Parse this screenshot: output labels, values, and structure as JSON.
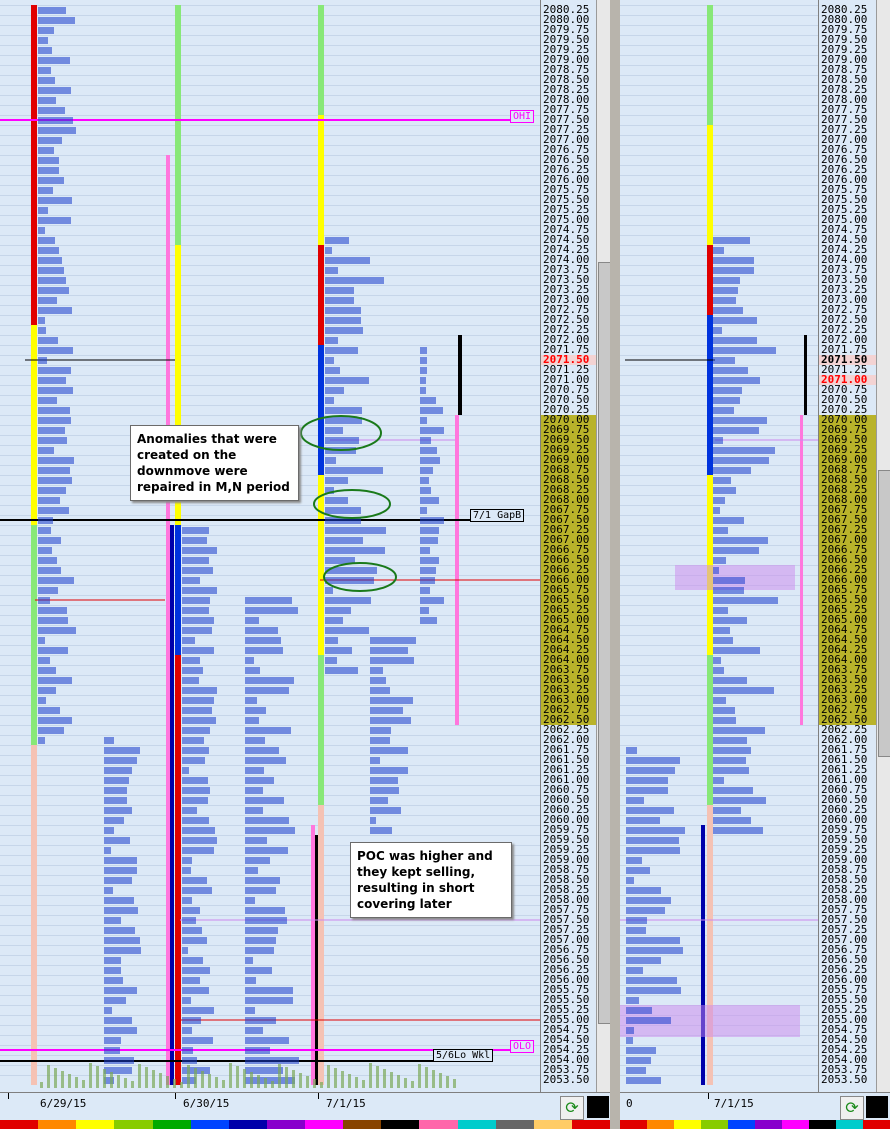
{
  "price_scale": {
    "prices": [
      "2080.25",
      "2080.00",
      "2079.75",
      "2079.50",
      "2079.25",
      "2079.00",
      "2078.75",
      "2078.50",
      "2078.25",
      "2078.00",
      "2077.75",
      "2077.50",
      "2077.25",
      "2077.00",
      "2076.75",
      "2076.50",
      "2076.25",
      "2076.00",
      "2075.75",
      "2075.50",
      "2075.25",
      "2075.00",
      "2074.75",
      "2074.50",
      "2074.25",
      "2074.00",
      "2073.75",
      "2073.50",
      "2073.25",
      "2073.00",
      "2072.75",
      "2072.50",
      "2072.25",
      "2072.00",
      "2071.75",
      "2071.50",
      "2071.25",
      "2071.00",
      "2070.75",
      "2070.50",
      "2070.25",
      "2070.00",
      "2069.75",
      "2069.50",
      "2069.25",
      "2069.00",
      "2068.75",
      "2068.50",
      "2068.25",
      "2068.00",
      "2067.75",
      "2067.50",
      "2067.25",
      "2067.00",
      "2066.75",
      "2066.50",
      "2066.25",
      "2066.00",
      "2065.75",
      "2065.50",
      "2065.25",
      "2065.00",
      "2064.75",
      "2064.50",
      "2064.25",
      "2064.00",
      "2063.75",
      "2063.50",
      "2063.25",
      "2063.00",
      "2062.75",
      "2062.50",
      "2062.25",
      "2062.00",
      "2061.75",
      "2061.50",
      "2061.25",
      "2061.00",
      "2060.75",
      "2060.50",
      "2060.25",
      "2060.00",
      "2059.75",
      "2059.50",
      "2059.25",
      "2059.00",
      "2058.75",
      "2058.50",
      "2058.25",
      "2058.00",
      "2057.75",
      "2057.50",
      "2057.25",
      "2057.00",
      "2056.75",
      "2056.50",
      "2056.25",
      "2056.00",
      "2055.75",
      "2055.50",
      "2055.25",
      "2055.00",
      "2054.75",
      "2054.50",
      "2054.25",
      "2054.00",
      "2053.75",
      "2053.50"
    ],
    "value_area_high": "2070.00",
    "value_area_low": "2062.50",
    "current_price": "2071.50",
    "right_pane_current_price": "2071.00"
  },
  "chart_data": [
    {
      "type": "market_profile",
      "pane": "left",
      "x_labels": [
        "6/29/15",
        "6/30/15",
        "7/1/15"
      ],
      "sessions": [
        {
          "date": "6/29/15",
          "high": 2080.25,
          "low": 2053.5
        },
        {
          "date": "6/30/15",
          "high": 2076.5,
          "low": 2053.5
        },
        {
          "date": "7/1/15",
          "high": 2080.25,
          "low": 2053.5
        }
      ],
      "reference_levels": [
        {
          "label": "OHI",
          "price": 2077.5,
          "color": "#ff00ff"
        },
        {
          "label": "7/1 GapB",
          "price": 2067.5,
          "color": "#000000"
        },
        {
          "label": "OLO",
          "price": 2054.25,
          "color": "#ff00ff"
        },
        {
          "label": "5/6Lo Wkl",
          "price": 2054.0,
          "color": "#000000"
        }
      ],
      "annotations": [
        "Anomalies that were created on the downmove were repaired in M,N period",
        "POC was higher and they kept selling, resulting in short covering later"
      ]
    },
    {
      "type": "market_profile",
      "pane": "right",
      "x_labels": [
        "0",
        "7/1/15"
      ],
      "value_area": {
        "high": 2070.0,
        "low": 2062.5
      },
      "current_price": 2071.0
    }
  ],
  "colors": {
    "background": "#dce9f7",
    "value_area": "#b9b32a",
    "letters": "#1a3ccc",
    "magenta": "#ff00ff",
    "current_price": "#ff0000"
  }
}
